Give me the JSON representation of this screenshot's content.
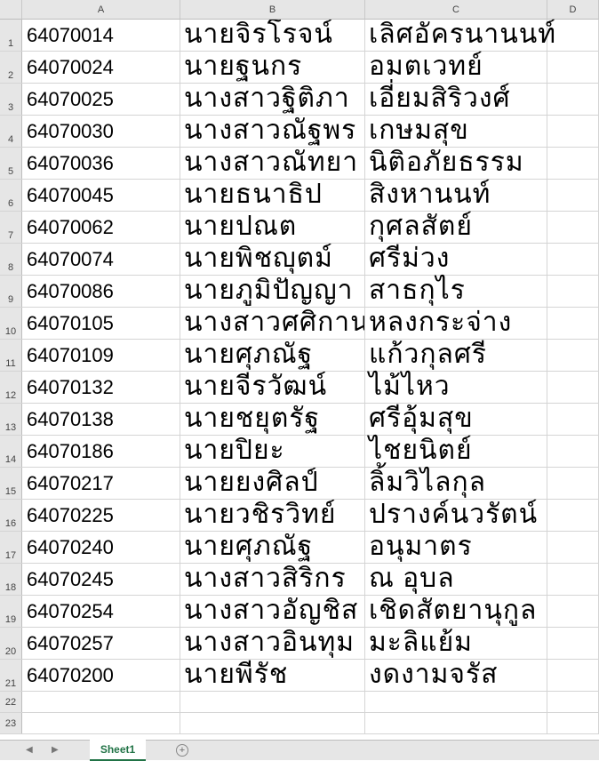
{
  "columns": [
    "A",
    "B",
    "C",
    "D"
  ],
  "rows": [
    {
      "num": "1",
      "a": "64070014",
      "b": "นายจิรโรจน์",
      "c": "เลิศอัครนานนท์"
    },
    {
      "num": "2",
      "a": "64070024",
      "b": "นายฐนกร",
      "c": "อมตเวทย์"
    },
    {
      "num": "3",
      "a": "64070025",
      "b": "นางสาวฐิติภา",
      "c": "เอี่ยมสิริวงศ์"
    },
    {
      "num": "4",
      "a": "64070030",
      "b": "นางสาวณัฐพร",
      "c": "เกษมสุข"
    },
    {
      "num": "5",
      "a": "64070036",
      "b": "นางสาวณัทยา",
      "c": "นิติอภัยธรรม"
    },
    {
      "num": "6",
      "a": "64070045",
      "b": "นายธนาธิป",
      "c": "สิงหานนท์"
    },
    {
      "num": "7",
      "a": "64070062",
      "b": "นายปณต",
      "c": "กุศลสัตย์"
    },
    {
      "num": "8",
      "a": "64070074",
      "b": "นายพิชญุตม์",
      "c": "ศรีม่วง"
    },
    {
      "num": "9",
      "a": "64070086",
      "b": "นายภูมิปัญญา",
      "c": "สาธกุไร"
    },
    {
      "num": "10",
      "a": "64070105",
      "b": "นางสาวศศิกาน",
      "c": "หลงกระจ่าง"
    },
    {
      "num": "11",
      "a": "64070109",
      "b": "นายศุภณัฐ",
      "c": "แก้วกุลศรี"
    },
    {
      "num": "12",
      "a": "64070132",
      "b": "นายจีรวัฒน์",
      "c": "ไม้ไหว"
    },
    {
      "num": "13",
      "a": "64070138",
      "b": "นายชยุตรัฐ",
      "c": "ศรีอุ้มสุข"
    },
    {
      "num": "14",
      "a": "64070186",
      "b": "นายปิยะ",
      "c": "ไชยนิตย์"
    },
    {
      "num": "15",
      "a": "64070217",
      "b": "นายยงศิลป์",
      "c": "ลิ้มวิไลกุล"
    },
    {
      "num": "16",
      "a": "64070225",
      "b": "นายวชิรวิทย์",
      "c": "ปรางค์นวรัตน์"
    },
    {
      "num": "17",
      "a": "64070240",
      "b": "นายศุภณัฐ",
      "c": "อนุมาตร"
    },
    {
      "num": "18",
      "a": "64070245",
      "b": "นางสาวสิริกร",
      "c": "ณ อุบล"
    },
    {
      "num": "19",
      "a": "64070254",
      "b": "นางสาวอัญชิส",
      "c": "เชิดสัตยานุกูล"
    },
    {
      "num": "20",
      "a": "64070257",
      "b": "นางสาวอินทุม",
      "c": "มะลิแย้ม"
    },
    {
      "num": "21",
      "a": "64070200",
      "b": "นายพีรัช",
      "c": "งดงามจรัส"
    }
  ],
  "empty_rows": [
    "22",
    "23"
  ],
  "sheet_tab": "Sheet1",
  "colors": {
    "accent": "#217346",
    "header_bg": "#e6e6e6",
    "gridline": "#d4d4d4"
  }
}
